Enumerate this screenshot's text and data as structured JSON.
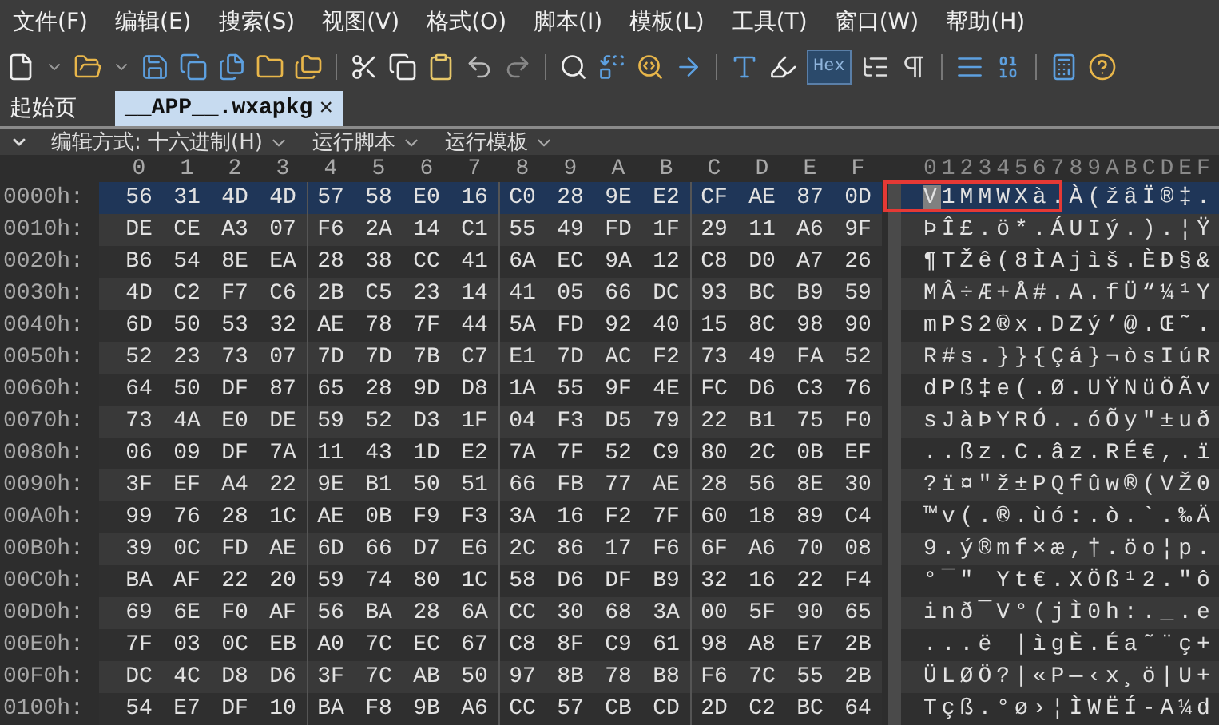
{
  "menu": [
    "文件(F)",
    "编辑(E)",
    "搜索(S)",
    "视图(V)",
    "格式(O)",
    "脚本(I)",
    "模板(L)",
    "工具(T)",
    "窗口(W)",
    "帮助(H)"
  ],
  "toolbar": {
    "hex_button": {
      "label": "Hex",
      "on": true
    }
  },
  "tabs": [
    {
      "label": "起始页",
      "selected": false
    },
    {
      "label": "__APP__.wxapkg",
      "selected": true,
      "close": "×"
    }
  ],
  "sub_toolbar": [
    "编辑方式: 十六进制(H)",
    "运行脚本",
    "运行模板"
  ],
  "hex_view": {
    "columns": [
      "0",
      "1",
      "2",
      "3",
      "4",
      "5",
      "6",
      "7",
      "8",
      "9",
      "A",
      "B",
      "C",
      "D",
      "E",
      "F"
    ],
    "ascii_header": "0123456789ABCDEF",
    "rows": [
      {
        "address": "0000h:",
        "bytes": [
          "56",
          "31",
          "4D",
          "4D",
          "57",
          "58",
          "E0",
          "16",
          "C0",
          "28",
          "9E",
          "E2",
          "CF",
          "AE",
          "87",
          "0D"
        ],
        "ascii": "V1MMWXà.À(žâÏ®‡.",
        "selected": true,
        "cursor": true
      },
      {
        "address": "0010h:",
        "bytes": [
          "DE",
          "CE",
          "A3",
          "07",
          "F6",
          "2A",
          "14",
          "C1",
          "55",
          "49",
          "FD",
          "1F",
          "29",
          "11",
          "A6",
          "9F"
        ],
        "ascii": "ÞÎ£.ö*.ÁUIý.).¦Ÿ",
        "selected": false,
        "cursor": false
      },
      {
        "address": "0020h:",
        "bytes": [
          "B6",
          "54",
          "8E",
          "EA",
          "28",
          "38",
          "CC",
          "41",
          "6A",
          "EC",
          "9A",
          "12",
          "C8",
          "D0",
          "A7",
          "26"
        ],
        "ascii": "¶TŽê(8ÌAjìš.ÈÐ§&",
        "selected": false,
        "cursor": false
      },
      {
        "address": "0030h:",
        "bytes": [
          "4D",
          "C2",
          "F7",
          "C6",
          "2B",
          "C5",
          "23",
          "14",
          "41",
          "05",
          "66",
          "DC",
          "93",
          "BC",
          "B9",
          "59"
        ],
        "ascii": "MÂ÷Æ+Å#.A.fÜ“¼¹Y",
        "selected": false,
        "cursor": false
      },
      {
        "address": "0040h:",
        "bytes": [
          "6D",
          "50",
          "53",
          "32",
          "AE",
          "78",
          "7F",
          "44",
          "5A",
          "FD",
          "92",
          "40",
          "15",
          "8C",
          "98",
          "90"
        ],
        "ascii": "mPS2®x.DZý’@.Œ˜.",
        "selected": false,
        "cursor": false
      },
      {
        "address": "0050h:",
        "bytes": [
          "52",
          "23",
          "73",
          "07",
          "7D",
          "7D",
          "7B",
          "C7",
          "E1",
          "7D",
          "AC",
          "F2",
          "73",
          "49",
          "FA",
          "52"
        ],
        "ascii": "R#s.}}{Çá}¬òsIúR",
        "selected": false,
        "cursor": false
      },
      {
        "address": "0060h:",
        "bytes": [
          "64",
          "50",
          "DF",
          "87",
          "65",
          "28",
          "9D",
          "D8",
          "1A",
          "55",
          "9F",
          "4E",
          "FC",
          "D6",
          "C3",
          "76"
        ],
        "ascii": "dPß‡e(.Ø.UŸNüÖÃv",
        "selected": false,
        "cursor": false
      },
      {
        "address": "0070h:",
        "bytes": [
          "73",
          "4A",
          "E0",
          "DE",
          "59",
          "52",
          "D3",
          "1F",
          "04",
          "F3",
          "D5",
          "79",
          "22",
          "B1",
          "75",
          "F0"
        ],
        "ascii": "sJàÞYRÓ..óÕy\"±uð",
        "selected": false,
        "cursor": false
      },
      {
        "address": "0080h:",
        "bytes": [
          "06",
          "09",
          "DF",
          "7A",
          "11",
          "43",
          "1D",
          "E2",
          "7A",
          "7F",
          "52",
          "C9",
          "80",
          "2C",
          "0B",
          "EF"
        ],
        "ascii": "..ßz.C.âz.RÉ€,.ï",
        "selected": false,
        "cursor": false
      },
      {
        "address": "0090h:",
        "bytes": [
          "3F",
          "EF",
          "A4",
          "22",
          "9E",
          "B1",
          "50",
          "51",
          "66",
          "FB",
          "77",
          "AE",
          "28",
          "56",
          "8E",
          "30"
        ],
        "ascii": "?ï¤\"ž±PQfûw®(VŽ0",
        "selected": false,
        "cursor": false
      },
      {
        "address": "00A0h:",
        "bytes": [
          "99",
          "76",
          "28",
          "1C",
          "AE",
          "0B",
          "F9",
          "F3",
          "3A",
          "16",
          "F2",
          "7F",
          "60",
          "18",
          "89",
          "C4"
        ],
        "ascii": "™v(.®.ùó:.ò.`.‰Ä",
        "selected": false,
        "cursor": false
      },
      {
        "address": "00B0h:",
        "bytes": [
          "39",
          "0C",
          "FD",
          "AE",
          "6D",
          "66",
          "D7",
          "E6",
          "2C",
          "86",
          "17",
          "F6",
          "6F",
          "A6",
          "70",
          "08"
        ],
        "ascii": "9.ý®mf×æ,†.öo¦p.",
        "selected": false,
        "cursor": false
      },
      {
        "address": "00C0h:",
        "bytes": [
          "BA",
          "AF",
          "22",
          "20",
          "59",
          "74",
          "80",
          "1C",
          "58",
          "D6",
          "DF",
          "B9",
          "32",
          "16",
          "22",
          "F4"
        ],
        "ascii": "°¯\" Yt€.XÖß¹2.\"ô",
        "selected": false,
        "cursor": false
      },
      {
        "address": "00D0h:",
        "bytes": [
          "69",
          "6E",
          "F0",
          "AF",
          "56",
          "BA",
          "28",
          "6A",
          "CC",
          "30",
          "68",
          "3A",
          "00",
          "5F",
          "90",
          "65"
        ],
        "ascii": "inð¯V°(jÌ0h:._.e",
        "selected": false,
        "cursor": false
      },
      {
        "address": "00E0h:",
        "bytes": [
          "7F",
          "03",
          "0C",
          "EB",
          "A0",
          "7C",
          "EC",
          "67",
          "C8",
          "8F",
          "C9",
          "61",
          "98",
          "A8",
          "E7",
          "2B"
        ],
        "ascii": "...ë |ìgÈ.Éa˜¨ç+",
        "selected": false,
        "cursor": false
      },
      {
        "address": "00F0h:",
        "bytes": [
          "DC",
          "4C",
          "D8",
          "D6",
          "3F",
          "7C",
          "AB",
          "50",
          "97",
          "8B",
          "78",
          "B8",
          "F6",
          "7C",
          "55",
          "2B"
        ],
        "ascii": "ÜLØÖ?|«P—‹x¸ö|U+",
        "selected": false,
        "cursor": false
      },
      {
        "address": "0100h:",
        "bytes": [
          "54",
          "E7",
          "DF",
          "10",
          "BA",
          "F8",
          "9B",
          "A6",
          "CC",
          "57",
          "CB",
          "CD",
          "2D",
          "C2",
          "BC",
          "64"
        ],
        "ascii": "Tçß.°ø›¦ÌWËÍ-A¼d",
        "selected": false,
        "cursor": false
      }
    ]
  }
}
